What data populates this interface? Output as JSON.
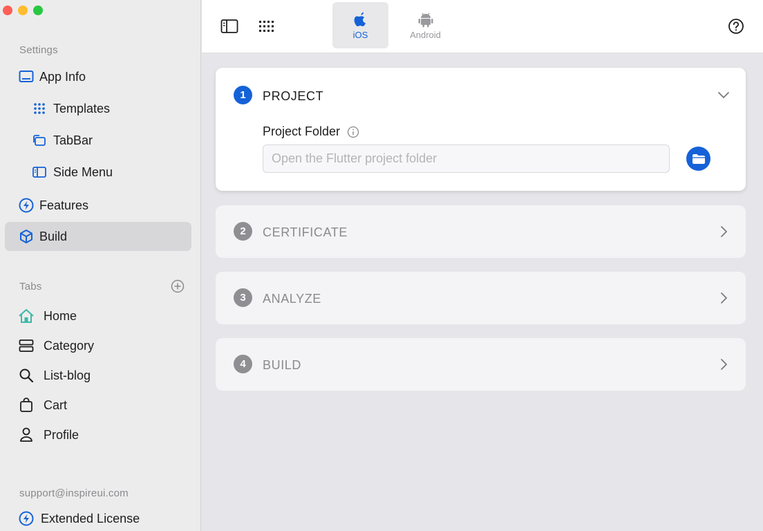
{
  "sidebar": {
    "settings_label": "Settings",
    "settings_items": [
      {
        "label": "App Info",
        "icon": "app-info-icon"
      },
      {
        "label": "Templates",
        "icon": "grid-icon"
      },
      {
        "label": "TabBar",
        "icon": "tabbar-icon"
      },
      {
        "label": "Side Menu",
        "icon": "side-menu-icon"
      },
      {
        "label": "Features",
        "icon": "bolt-icon"
      },
      {
        "label": "Build",
        "icon": "cube-icon",
        "active": true
      }
    ],
    "tabs_label": "Tabs",
    "tab_items": [
      {
        "label": "Home",
        "icon": "home-icon"
      },
      {
        "label": "Category",
        "icon": "category-icon"
      },
      {
        "label": "List-blog",
        "icon": "search-icon"
      },
      {
        "label": "Cart",
        "icon": "bag-icon"
      },
      {
        "label": "Profile",
        "icon": "person-icon"
      }
    ],
    "support_email": "support@inspireui.com",
    "extended_license": "Extended License"
  },
  "topbar": {
    "platforms": [
      {
        "label": "iOS",
        "icon": "apple-icon",
        "selected": true
      },
      {
        "label": "Android",
        "icon": "android-icon",
        "selected": false
      }
    ]
  },
  "steps": [
    {
      "number": "1",
      "title": "PROJECT",
      "expanded": true
    },
    {
      "number": "2",
      "title": "CERTIFICATE",
      "expanded": false
    },
    {
      "number": "3",
      "title": "ANALYZE",
      "expanded": false
    },
    {
      "number": "4",
      "title": "BUILD",
      "expanded": false
    }
  ],
  "project": {
    "folder_label": "Project Folder",
    "folder_value": "",
    "folder_placeholder": "Open the Flutter project folder"
  },
  "colors": {
    "accent": "#1562d8",
    "home_icon": "#3bb8a6",
    "active_item_bg": "#d7d7d9"
  }
}
